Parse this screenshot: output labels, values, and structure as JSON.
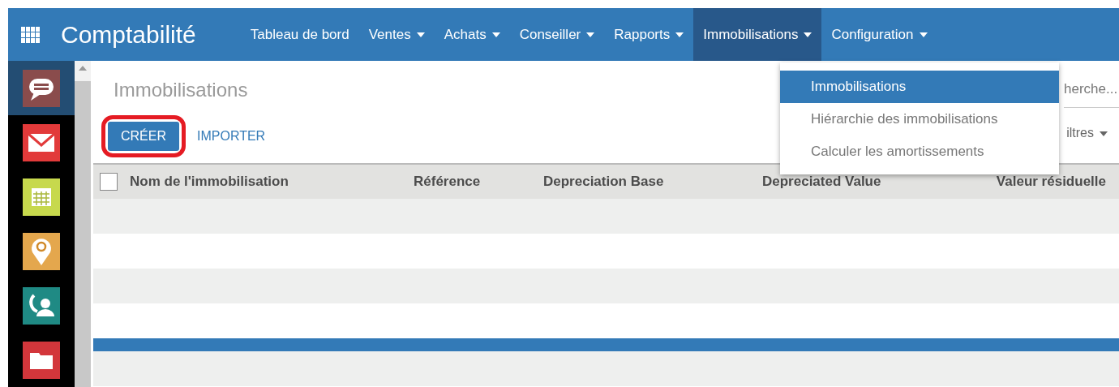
{
  "app_title": "Comptabilité",
  "menu": [
    {
      "label": "Tableau de bord",
      "kind": "link",
      "open": false
    },
    {
      "label": "Ventes",
      "kind": "dropdown",
      "open": false
    },
    {
      "label": "Achats",
      "kind": "dropdown",
      "open": false
    },
    {
      "label": "Conseiller",
      "kind": "dropdown",
      "open": false
    },
    {
      "label": "Rapports",
      "kind": "dropdown",
      "open": false
    },
    {
      "label": "Immobilisations",
      "kind": "dropdown",
      "open": true
    },
    {
      "label": "Configuration",
      "kind": "dropdown",
      "open": false
    }
  ],
  "dropdown": [
    {
      "label": "Immobilisations",
      "selected": true
    },
    {
      "label": "Hiérarchie des immobilisations",
      "selected": false
    },
    {
      "label": "Calculer les amortissements",
      "selected": false
    }
  ],
  "sidebar": [
    {
      "kind": "chat",
      "selected": true
    },
    {
      "kind": "mail",
      "selected": false
    },
    {
      "kind": "calendar",
      "selected": false
    },
    {
      "kind": "pin",
      "selected": false
    },
    {
      "kind": "phone",
      "selected": false
    },
    {
      "kind": "folder",
      "selected": false
    }
  ],
  "page_title": "Immobilisations",
  "buttons": [
    {
      "label": "CRÉER",
      "kind": "primary",
      "highlighted": true
    },
    {
      "label": "IMPORTER",
      "kind": "link",
      "highlighted": false
    }
  ],
  "search": {
    "placeholder": "herche..."
  },
  "filters": "iltres",
  "table": {
    "all_checked": false,
    "columns": [
      "Nom de l'immobilisation",
      "Référence",
      "Depreciation Base",
      "Depreciated Value",
      "Valeur résiduelle"
    ],
    "rows": [
      {
        "selected": false
      },
      {
        "selected": false
      },
      {
        "selected": false
      },
      {
        "selected": false
      },
      {
        "selected": true
      },
      {
        "selected": false
      }
    ]
  }
}
